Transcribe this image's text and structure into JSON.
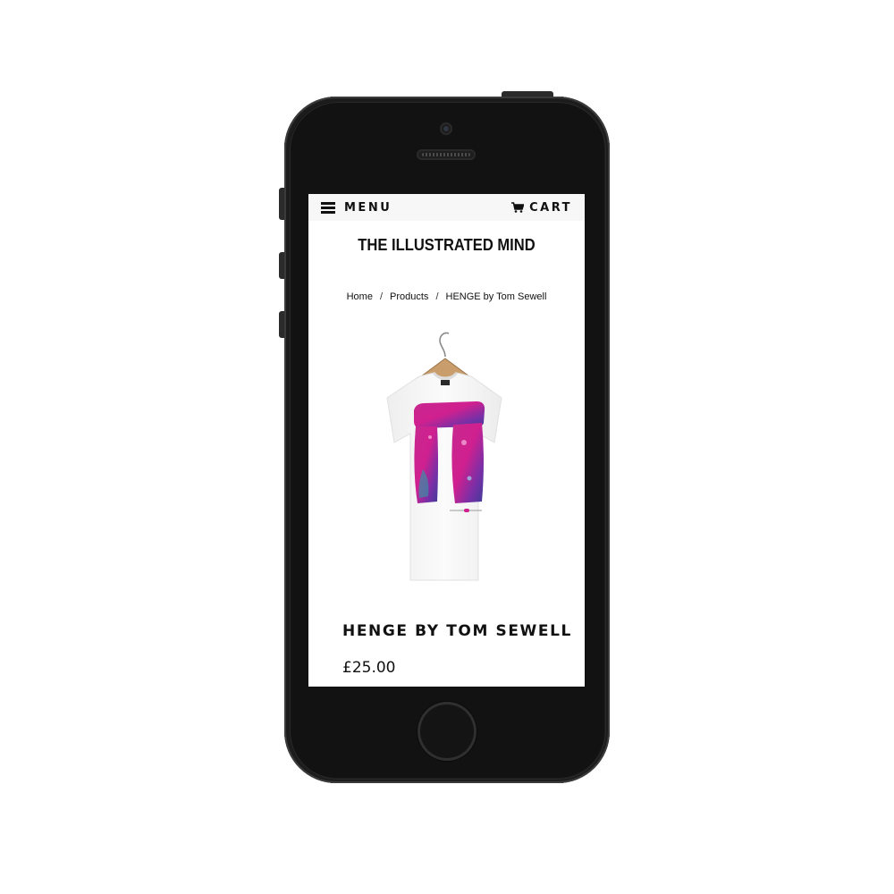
{
  "header": {
    "menu_label": "MENU",
    "cart_label": "CART"
  },
  "store": {
    "title": "THE ILLUSTRATED MIND"
  },
  "breadcrumb": {
    "items": [
      "Home",
      "Products",
      "HENGE by Tom Sewell"
    ],
    "separator": "/"
  },
  "product": {
    "title": "HENGE BY TOM SEWELL",
    "price": "£25.00",
    "image_subject": "t-shirt-on-hanger"
  },
  "colors": {
    "screen_background": "#ffffff",
    "text": "#111111",
    "phone_body": "#121212",
    "print_magenta": "#d0208f",
    "print_purple": "#6a2fa6"
  }
}
